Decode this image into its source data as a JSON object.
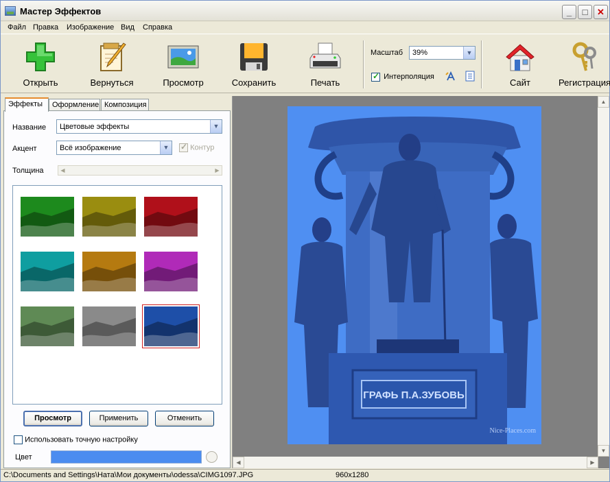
{
  "window": {
    "title": "Мастер Эффектов",
    "minimize": "_",
    "maximize": "□",
    "close": "✕"
  },
  "menu": [
    "Файл",
    "Правка",
    "Изображение",
    "Вид",
    "Справка"
  ],
  "toolbar": {
    "open": "Открыть",
    "back": "Вернуться",
    "preview": "Просмотр",
    "save": "Сохранить",
    "print": "Печать",
    "zoom_label": "Масштаб",
    "zoom_value": "39%",
    "interpolation_label": "Интерполяция",
    "interpolation_checked": true,
    "site": "Сайт",
    "register": "Регистрация"
  },
  "tabs": [
    "Эффекты",
    "Оформление",
    "Композиция"
  ],
  "effects": {
    "name_label": "Название",
    "name_value": "Цветовые эффекты",
    "accent_label": "Акцент",
    "accent_value": "Всё изображение",
    "contour_label": "Контур",
    "contour_checked": true,
    "thickness_label": "Толщина",
    "thumbnails": [
      {
        "tint": "#1d8a1d"
      },
      {
        "tint": "#9a8d10"
      },
      {
        "tint": "#b0101a"
      },
      {
        "tint": "#0f9ea0"
      },
      {
        "tint": "#b57a10"
      },
      {
        "tint": "#b02ab8"
      },
      {
        "tint": "#5f8a55"
      },
      {
        "tint": "#8a8a8a"
      },
      {
        "tint": "#1e4fa8"
      }
    ],
    "selected_index": 8,
    "preview_button": "Просмотр",
    "apply_button": "Применить",
    "cancel_button": "Отменить",
    "fine_tune_label": "Использовать точную настройку",
    "fine_tune_checked": false,
    "color_label": "Цвет",
    "color_value": "#4b8cf0"
  },
  "photo": {
    "plaque": "ГРАФЬ П.А.ЗУБОВЬ",
    "watermark": "Nice-Places.com"
  },
  "status": {
    "path": "C:\\Documents and Settings\\Ната\\Мои документы\\odessa\\CIMG1097.JPG",
    "size": "960x1280"
  }
}
